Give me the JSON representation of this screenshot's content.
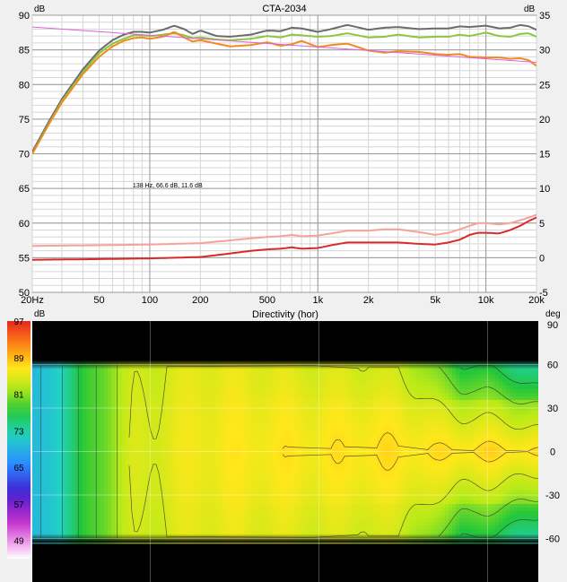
{
  "colors": {
    "background": "#f0f0f0",
    "plot_bg": "#ffffff",
    "grid_major": "#9a9a9a",
    "grid_minor": "#d6d6d6",
    "on_axis": "#6b6b6b",
    "listening_window": "#8cc63f",
    "early_reflections": "#f08c1e",
    "sound_power_di": "#f4a29a",
    "early_reflections_di": "#d92a2a",
    "target_slope": "#e060e0"
  },
  "chart_data": [
    {
      "type": "line",
      "title": "CTA-2034",
      "x_scale": "log",
      "xlim": [
        20,
        20000
      ],
      "x_ticks": [
        20,
        50,
        100,
        200,
        500,
        1000,
        2000,
        5000,
        10000,
        20000
      ],
      "x_tick_labels": [
        "20Hz",
        "50",
        "100",
        "200",
        "500",
        "1k",
        "2k",
        "5k",
        "10k",
        "20k"
      ],
      "y_left": {
        "label": "dB",
        "range": [
          50,
          90
        ],
        "ticks": [
          50,
          55,
          60,
          65,
          70,
          75,
          80,
          85,
          90
        ]
      },
      "y_right": {
        "label": "dB",
        "range": [
          -5,
          35
        ],
        "ticks": [
          -5,
          0,
          5,
          10,
          15,
          20,
          25,
          30,
          35
        ]
      },
      "grid": true,
      "annotation": "138 Hz, 66.6 dB, 11.6 dB",
      "series": [
        {
          "key": "on_axis",
          "axis": "left",
          "x": [
            20,
            25,
            30,
            40,
            50,
            60,
            70,
            80,
            90,
            100,
            120,
            140,
            160,
            180,
            200,
            250,
            300,
            400,
            500,
            600,
            700,
            800,
            1000,
            1200,
            1500,
            2000,
            2500,
            3000,
            4000,
            5000,
            6000,
            7000,
            8000,
            10000,
            12000,
            14000,
            16000,
            18000,
            20000
          ],
          "y": [
            70.3,
            74.6,
            77.9,
            82.2,
            84.9,
            86.4,
            87.2,
            87.6,
            87.6,
            87.5,
            87.9,
            88.5,
            88.0,
            87.3,
            87.8,
            87.0,
            86.9,
            87.2,
            87.8,
            87.7,
            88.2,
            88.1,
            87.6,
            88.0,
            88.6,
            87.9,
            88.2,
            88.3,
            88.0,
            88.1,
            88.1,
            88.4,
            88.3,
            88.5,
            88.1,
            88.2,
            88.6,
            88.4,
            87.9
          ]
        },
        {
          "key": "listening_window",
          "axis": "left",
          "x": [
            20,
            25,
            30,
            40,
            50,
            60,
            70,
            80,
            90,
            100,
            120,
            140,
            160,
            180,
            200,
            250,
            300,
            400,
            500,
            600,
            700,
            800,
            1000,
            1200,
            1500,
            2000,
            2500,
            3000,
            4000,
            5000,
            6000,
            7000,
            8000,
            10000,
            12000,
            14000,
            16000,
            18000,
            20000
          ],
          "y": [
            70.0,
            74.3,
            77.6,
            81.8,
            84.5,
            85.9,
            86.6,
            87.1,
            87.1,
            87.0,
            87.2,
            87.4,
            87.1,
            86.7,
            86.8,
            86.5,
            86.4,
            86.6,
            87.0,
            86.8,
            87.2,
            87.1,
            86.9,
            87.0,
            87.4,
            86.8,
            86.9,
            87.2,
            86.8,
            86.9,
            86.9,
            87.2,
            87.0,
            87.5,
            87.0,
            86.9,
            87.3,
            87.4,
            86.9
          ]
        },
        {
          "key": "early_reflections",
          "axis": "left",
          "x": [
            20,
            25,
            30,
            40,
            50,
            60,
            70,
            80,
            90,
            100,
            120,
            140,
            160,
            180,
            200,
            250,
            300,
            400,
            500,
            600,
            700,
            800,
            1000,
            1200,
            1500,
            2000,
            2500,
            3000,
            4000,
            5000,
            6000,
            7000,
            8000,
            10000,
            12000,
            14000,
            16000,
            18000,
            20000
          ],
          "y": [
            70.0,
            74.2,
            77.4,
            81.5,
            84.0,
            85.5,
            86.3,
            86.7,
            86.8,
            86.6,
            86.9,
            87.6,
            86.8,
            86.2,
            86.4,
            85.9,
            85.5,
            85.7,
            86.1,
            85.6,
            85.8,
            86.3,
            85.4,
            85.7,
            85.9,
            84.9,
            84.6,
            84.8,
            84.7,
            84.4,
            84.3,
            84.4,
            84.0,
            83.9,
            83.9,
            83.7,
            83.8,
            83.5,
            82.7
          ]
        },
        {
          "key": "target_slope",
          "axis": "left",
          "x": [
            20,
            20000
          ],
          "y": [
            88.3,
            83.2
          ]
        },
        {
          "key": "sound_power_di",
          "axis": "right",
          "x": [
            20,
            50,
            100,
            200,
            300,
            400,
            500,
            600,
            700,
            800,
            1000,
            1200,
            1500,
            2000,
            2500,
            3000,
            4000,
            5000,
            6000,
            7000,
            8000,
            9000,
            10000,
            12000,
            14000,
            16000,
            18000,
            20000
          ],
          "y": [
            1.7,
            1.8,
            1.9,
            2.1,
            2.5,
            2.8,
            3.0,
            3.1,
            3.3,
            3.1,
            3.2,
            3.5,
            3.9,
            3.9,
            4.1,
            4.1,
            3.7,
            3.3,
            3.6,
            4.1,
            4.6,
            5.0,
            5.0,
            4.8,
            5.0,
            5.4,
            5.8,
            6.2
          ]
        },
        {
          "key": "early_reflections_di",
          "axis": "right",
          "x": [
            20,
            50,
            100,
            200,
            300,
            400,
            500,
            600,
            700,
            800,
            1000,
            1200,
            1500,
            2000,
            2500,
            3000,
            4000,
            5000,
            6000,
            7000,
            8000,
            9000,
            10000,
            12000,
            14000,
            16000,
            18000,
            20000
          ],
          "y": [
            -0.3,
            -0.2,
            -0.1,
            0.1,
            0.6,
            1.0,
            1.2,
            1.3,
            1.5,
            1.3,
            1.4,
            1.8,
            2.2,
            2.2,
            2.2,
            2.2,
            2.0,
            1.9,
            2.2,
            2.6,
            3.3,
            3.6,
            3.6,
            3.5,
            4.0,
            4.6,
            5.3,
            5.8
          ]
        }
      ]
    },
    {
      "type": "heatmap",
      "title": "Directivity (hor)",
      "x_scale": "log",
      "xlim": [
        20,
        20000
      ],
      "z_label": "dB",
      "y_label": "deg",
      "ylim": [
        -90,
        90
      ],
      "y_ticks": [
        90,
        60,
        30,
        0,
        -30,
        -60
      ],
      "colorbar": {
        "range": [
          45,
          97
        ],
        "ticks": [
          97,
          89,
          81,
          73,
          65,
          57,
          49
        ]
      },
      "rolloff_freq": [
        20,
        40,
        60,
        80,
        100,
        300,
        600,
        1000,
        2000,
        3000,
        4000,
        5000,
        6000,
        7000,
        8000,
        10000,
        12000,
        15000,
        20000
      ],
      "rolloff_db_per_deg": [
        0.0,
        0.0,
        0.0,
        0.01,
        0.01,
        0.015,
        0.025,
        0.03,
        0.04,
        0.05,
        0.07,
        0.1,
        0.12,
        0.14,
        0.14,
        0.15,
        0.16,
        0.17,
        0.19
      ],
      "level_freq": [
        20,
        25,
        30,
        35,
        40,
        50,
        60,
        70,
        80,
        100,
        200,
        500,
        1000,
        2000,
        5000,
        10000,
        20000
      ],
      "level_db": [
        69,
        71,
        73,
        75,
        77,
        79.5,
        81.5,
        83,
        84,
        84.5,
        86,
        86.5,
        86.5,
        87,
        87,
        87.5,
        87
      ],
      "contour_step_db": 3,
      "dark_above_deg": 60,
      "dark_below_deg": -60
    }
  ]
}
